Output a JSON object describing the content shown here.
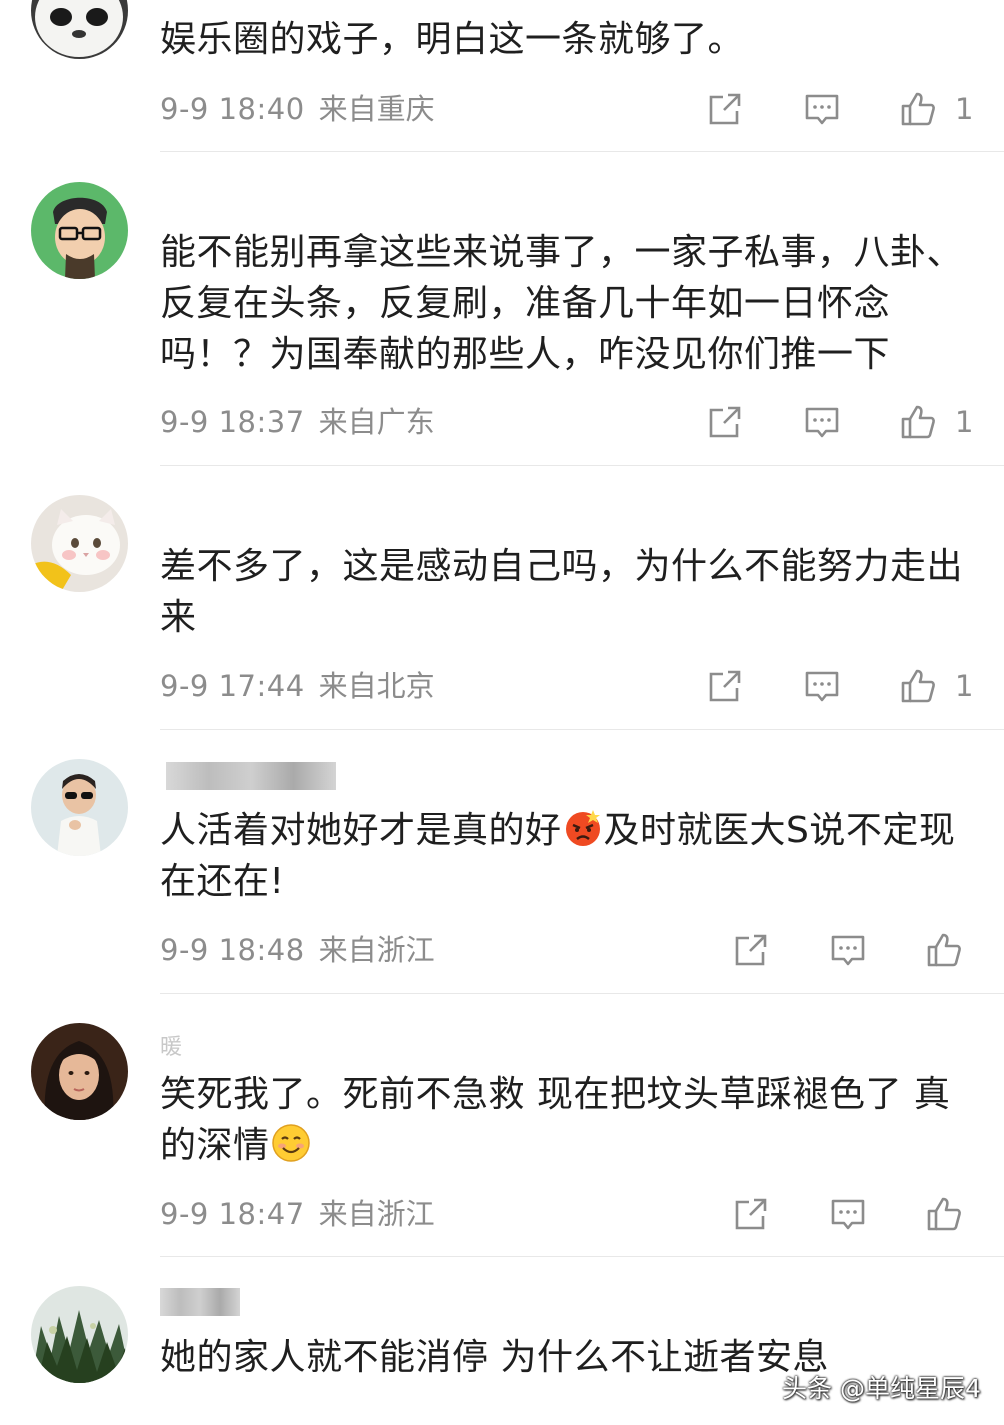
{
  "comments": [
    {
      "username": "",
      "text": "娱乐圈的戏子，明白这一条就够了。",
      "time": "9-9 18:40",
      "location": "来自重庆",
      "likes": "1",
      "avatar_icon": "panda-avatar"
    },
    {
      "username": "",
      "text": "能不能别再拿这些来说事了，一家子私事，八卦、反复在头条，反复刷，准备几十年如一日怀念吗！？为国奉献的那些人，咋没见你们推一下",
      "time": "9-9 18:37",
      "location": "来自广东",
      "likes": "1",
      "avatar_icon": "glasses-man-avatar"
    },
    {
      "username": "",
      "text": "差不多了，这是感动自己吗，为什么不能努力走出来",
      "time": "9-9 17:44",
      "location": "来自北京",
      "likes": "1",
      "avatar_icon": "white-cat-avatar"
    },
    {
      "username": "",
      "text_before_emoji": "人活着对她好才是真的好",
      "emoji": "angry-face-emoji",
      "text_after_emoji": "及时就医大S说不定现在还在!",
      "time": "9-9 18:48",
      "location": "来自浙江",
      "likes": "",
      "avatar_icon": "child-sunglasses-avatar"
    },
    {
      "username": "暖",
      "text_before_emoji": "笑死我了。死前不急救 现在把坟头草踩褪色了 真的深情",
      "emoji": "smiling-face-emoji",
      "time": "9-9 18:47",
      "location": "来自浙江",
      "likes": "",
      "avatar_icon": "girl-portrait-avatar"
    },
    {
      "username": "",
      "text": "她的家人就不能消停 为什么不让逝者安息",
      "avatar_icon": "plants-avatar"
    }
  ],
  "watermark": "头条 @单纯星辰4",
  "icons": {
    "share": "share-icon",
    "reply": "comment-icon",
    "like": "thumbs-up-icon"
  },
  "colors": {
    "meta_text": "#8c8c8c",
    "body_text": "#1f1f1f",
    "divider": "#e8e8e8"
  }
}
